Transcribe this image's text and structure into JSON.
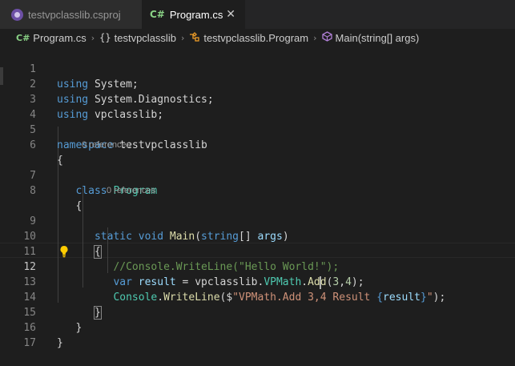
{
  "tabs": [
    {
      "label": "testvpclasslib.csproj",
      "icon": "csproj-icon",
      "active": false
    },
    {
      "label": "Program.cs",
      "icon": "csharp-file-icon",
      "icon_text": "C#",
      "active": true,
      "close": "✕"
    }
  ],
  "breadcrumb": {
    "file_icon_text": "C#",
    "file": "Program.cs",
    "namespace_icon_text": "{}",
    "namespace": "testvpclasslib",
    "class": "testvpclasslib.Program",
    "method": "Main(string[] args)",
    "separator": "›"
  },
  "editor": {
    "active_line": 12,
    "codelens": [
      {
        "before_line": 7,
        "text": "0 references"
      },
      {
        "before_line": 9,
        "text": "0 references"
      }
    ],
    "lines": [
      {
        "n": "1"
      },
      {
        "n": "2"
      },
      {
        "n": "3"
      },
      {
        "n": "4"
      },
      {
        "n": "5"
      },
      {
        "n": "6"
      },
      {
        "n": "7"
      },
      {
        "n": "8"
      },
      {
        "n": "9"
      },
      {
        "n": "10"
      },
      {
        "n": "11"
      },
      {
        "n": "12"
      },
      {
        "n": "13"
      },
      {
        "n": "14"
      },
      {
        "n": "15"
      },
      {
        "n": "16"
      },
      {
        "n": "17"
      }
    ],
    "tokens": {
      "using": "using",
      "system": "System;",
      "system_diag": "System.Diagnostics;",
      "vpclasslib": "vpclasslib;",
      "namespace_kw": "namespace",
      "namespace_name": "testvpclasslib",
      "open_brace": "{",
      "close_brace": "}",
      "class_kw": "class",
      "class_name": "Program",
      "static_kw": "static",
      "void_kw": "void",
      "main": "Main",
      "paren_open": "(",
      "string_kw": "string",
      "brackets": "[]",
      "args": "args",
      "paren_close": ")",
      "comment": "//Console.WriteLine(\"Hello World!\");",
      "var_kw": "var",
      "result": "result",
      "assign": " = vpclasslib.",
      "vpmath": "VPMath",
      "dot": ".",
      "add_a": "Ad",
      "add_b": "d",
      "args_34_open": "(",
      "num3": "3",
      "comma": ",",
      "num4": "4",
      "end_stmt": ");",
      "console": "Console",
      "writeline": "WriteLine",
      "interp_open": "($",
      "str_part": "\"VPMath.Add 3,4 Result ",
      "interp_lb": "{",
      "interp_result": "result",
      "interp_rb": "}",
      "str_end": "\"",
      "close_call": ");"
    }
  },
  "colors": {
    "background": "#1e1e1e",
    "keyword": "#569cd6",
    "type": "#4ec9b0",
    "function": "#dcdcaa",
    "variable": "#9cdcfe",
    "string": "#ce9178",
    "number": "#b5cea8",
    "comment": "#6a9955"
  }
}
